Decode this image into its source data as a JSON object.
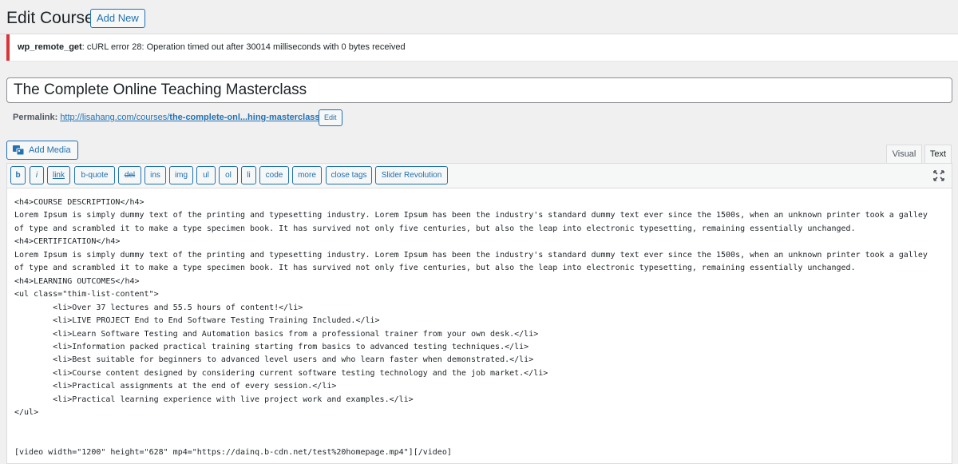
{
  "header": {
    "title": "Edit Course",
    "add_new_label": "Add New"
  },
  "notice": {
    "code": "wp_remote_get",
    "message": ": cURL error 28: Operation timed out after 30014 milliseconds with 0 bytes received",
    "color": "#d63638"
  },
  "post": {
    "title": "The Complete Online Teaching Masterclass"
  },
  "permalink": {
    "label": "Permalink:",
    "url_base": "http://lisahang.com/courses/",
    "url_slug": "the-complete-onl...hing-masterclass/",
    "edit_label": "Edit"
  },
  "editor": {
    "add_media_label": "Add Media",
    "tabs": [
      "Visual",
      "Text"
    ],
    "active_tab": "Text",
    "quicktags": [
      "b",
      "i",
      "link",
      "b-quote",
      "del",
      "ins",
      "img",
      "ul",
      "ol",
      "li",
      "code",
      "more",
      "close tags",
      "Slider Revolution"
    ],
    "content": "<h4>COURSE DESCRIPTION</h4>\nLorem Ipsum is simply dummy text of the printing and typesetting industry. Lorem Ipsum has been the industry's standard dummy text ever since the 1500s, when an unknown printer took a galley\nof type and scrambled it to make a type specimen book. It has survived not only five centuries, but also the leap into electronic typesetting, remaining essentially unchanged.\n<h4>CERTIFICATION</h4>\nLorem Ipsum is simply dummy text of the printing and typesetting industry. Lorem Ipsum has been the industry's standard dummy text ever since the 1500s, when an unknown printer took a galley\nof type and scrambled it to make a type specimen book. It has survived not only five centuries, but also the leap into electronic typesetting, remaining essentially unchanged.\n<h4>LEARNING OUTCOMES</h4>\n<ul class=\"thim-list-content\">\n        <li>Over 37 lectures and 55.5 hours of content!</li>\n        <li>LIVE PROJECT End to End Software Testing Training Included.</li>\n        <li>Learn Software Testing and Automation basics from a professional trainer from your own desk.</li>\n        <li>Information packed practical training starting from basics to advanced testing techniques.</li>\n        <li>Best suitable for beginners to advanced level users and who learn faster when demonstrated.</li>\n        <li>Course content designed by considering current software testing technology and the job market.</li>\n        <li>Practical assignments at the end of every session.</li>\n        <li>Practical learning experience with live project work and examples.</li>\n</ul>\n\n\n[video width=\"1200\" height=\"628\" mp4=\"https://dainq.b-cdn.net/test%20homepage.mp4\"][/video]"
  },
  "colors": {
    "accent": "#2271b1",
    "error": "#d63638",
    "background": "#f0f0f1"
  }
}
